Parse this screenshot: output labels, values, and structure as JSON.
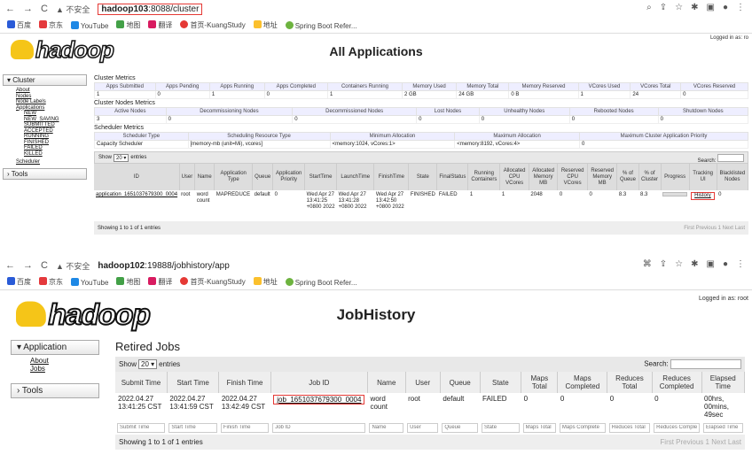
{
  "p1": {
    "addr": {
      "warn": "▲ 不安全",
      "url_host": "hadoop103",
      "url_rest": ":8088/cluster"
    },
    "bookmarks": [
      "百度",
      "京东",
      "YouTube",
      "地图",
      "翻译",
      "首页-KuangStudy",
      "地址",
      "Spring Boot Refer..."
    ],
    "title": "All Applications",
    "logged": "Logged in as: ro",
    "sidebar": {
      "cluster": "▾ Cluster",
      "links": [
        "About",
        "Nodes",
        "Node Labels",
        "Applications"
      ],
      "sub": [
        "NEW",
        "NEW_SAVING",
        "SUBMITTED",
        "ACCEPTED",
        "RUNNING",
        "FINISHED",
        "FAILED",
        "KILLED"
      ],
      "scheduler": "Scheduler",
      "tools": "› Tools"
    },
    "cm": {
      "title": "Cluster Metrics",
      "h": [
        "Apps Submitted",
        "Apps Pending",
        "Apps Running",
        "Apps Completed",
        "Containers Running",
        "Memory Used",
        "Memory Total",
        "Memory Reserved",
        "VCores Used",
        "VCores Total",
        "VCores Reserved"
      ],
      "v": [
        "1",
        "0",
        "1",
        "0",
        "1",
        "2 GB",
        "24 GB",
        "0 B",
        "1",
        "24",
        "0"
      ]
    },
    "cn": {
      "title": "Cluster Nodes Metrics",
      "h": [
        "Active Nodes",
        "Decommissioning Nodes",
        "Decommissioned Nodes",
        "Lost Nodes",
        "Unhealthy Nodes",
        "Rebooted Nodes",
        "Shutdown Nodes"
      ],
      "v": [
        "3",
        "0",
        "0",
        "0",
        "0",
        "0",
        "0"
      ]
    },
    "sm": {
      "title": "Scheduler Metrics",
      "h": [
        "Scheduler Type",
        "Scheduling Resource Type",
        "Minimum Allocation",
        "Maximum Allocation",
        "Maximum Cluster Application Priority"
      ],
      "v": [
        "Capacity Scheduler",
        "[memory-mb (unit=Mi), vcores]",
        "<memory:1024, vCores:1>",
        "<memory:8192, vCores:4>",
        "0"
      ]
    },
    "show": "Show",
    "show_val": "20 ▾",
    "entries": "entries",
    "search": "Search:",
    "apps": {
      "h": [
        "ID",
        "User",
        "Name",
        "Application Type",
        "Queue",
        "Application Priority",
        "StartTime",
        "LaunchTime",
        "FinishTime",
        "State",
        "FinalStatus",
        "Running Containers",
        "Allocated CPU VCores",
        "Allocated Memory MB",
        "Reserved CPU VCores",
        "Reserved Memory MB",
        "% of Queue",
        "% of Cluster",
        "Progress",
        "Tracking UI",
        "Blacklisted Nodes"
      ],
      "row": [
        "application_1651037679300_0004",
        "root",
        "word count",
        "MAPREDUCE",
        "default",
        "0",
        "Wed Apr 27 13:41:25 +0800 2022",
        "Wed Apr 27 13:41:28 +0800 2022",
        "Wed Apr 27 13:42:50 +0800 2022",
        "FINISHED",
        "FAILED",
        "1",
        "1",
        "2048",
        "0",
        "0",
        "8.3",
        "8.3",
        "",
        "History",
        "0"
      ]
    },
    "foot": "Showing 1 to 1 of 1 entries",
    "pager": "First  Previous  1  Next  Last"
  },
  "p2": {
    "addr": {
      "warn": "▲ 不安全",
      "url_host": "hadoop102",
      "url_rest": ":19888/jobhistory/app"
    },
    "bookmarks": [
      "百度",
      "京东",
      "YouTube",
      "地图",
      "翻译",
      "首页-KuangStudy",
      "地址",
      "Spring Boot Refer..."
    ],
    "title": "JobHistory",
    "logged": "Logged in as: root",
    "sidebar": {
      "app": "▾ Application",
      "links": [
        "About",
        "Jobs"
      ],
      "tools": "› Tools"
    },
    "heading": "Retired Jobs",
    "show": "Show",
    "show_val": "20 ▾",
    "entries": "entries",
    "search": "Search:",
    "jobs": {
      "h": [
        "Submit Time",
        "Start Time",
        "Finish Time",
        "Job ID",
        "Name",
        "User",
        "Queue",
        "State",
        "Maps Total",
        "Maps Completed",
        "Reduces Total",
        "Reduces Completed",
        "Elapsed Time"
      ],
      "row": [
        "2022.04.27 13:41:25 CST",
        "2022.04.27 13:41:59 CST",
        "2022.04.27 13:42:49 CST",
        "job_1651037679300_0004",
        "word count",
        "root",
        "default",
        "FAILED",
        "0",
        "0",
        "0",
        "0",
        "00hrs, 00mins, 49sec"
      ],
      "filters": [
        "Submit Time",
        "Start Time",
        "Finish Time",
        "Job ID",
        "Name",
        "User",
        "Queue",
        "State",
        "Maps Total",
        "Maps Complete",
        "Reduces Total",
        "Reduces Comple",
        "Elapsed Time"
      ]
    },
    "foot": "Showing 1 to 1 of 1 entries",
    "pager": "First  Previous  1  Next  Last"
  }
}
